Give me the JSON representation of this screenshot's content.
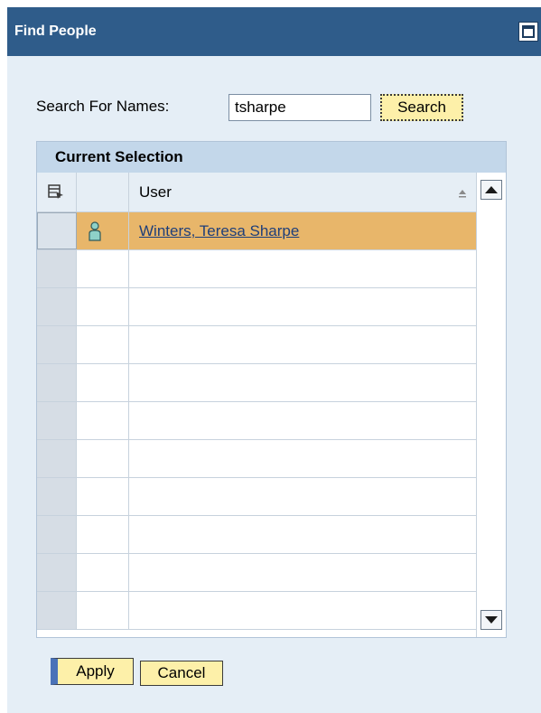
{
  "dialog": {
    "title": "Find People"
  },
  "search": {
    "label": "Search For Names:",
    "value": "tsharpe",
    "button_label": "Search"
  },
  "grid": {
    "caption": "Current Selection",
    "columns": [
      "User"
    ],
    "rows": [
      {
        "user": "Winters, Teresa Sharpe",
        "selected": true
      },
      {
        "user": ""
      },
      {
        "user": ""
      },
      {
        "user": ""
      },
      {
        "user": ""
      },
      {
        "user": ""
      },
      {
        "user": ""
      },
      {
        "user": ""
      },
      {
        "user": ""
      },
      {
        "user": ""
      },
      {
        "user": ""
      }
    ]
  },
  "footer": {
    "apply_label": "Apply",
    "cancel_label": "Cancel"
  },
  "colors": {
    "titlebar": "#2f5c8a",
    "background": "#e5eef6",
    "selected_row": "#e8b66a",
    "button": "#fdf0a9"
  },
  "icons": {
    "window": "maximize-icon",
    "column_menu": "column-settings-icon",
    "sort": "sort-ascending-icon",
    "person": "person-icon",
    "scroll_up": "scroll-up-icon",
    "scroll_down": "scroll-down-icon"
  }
}
